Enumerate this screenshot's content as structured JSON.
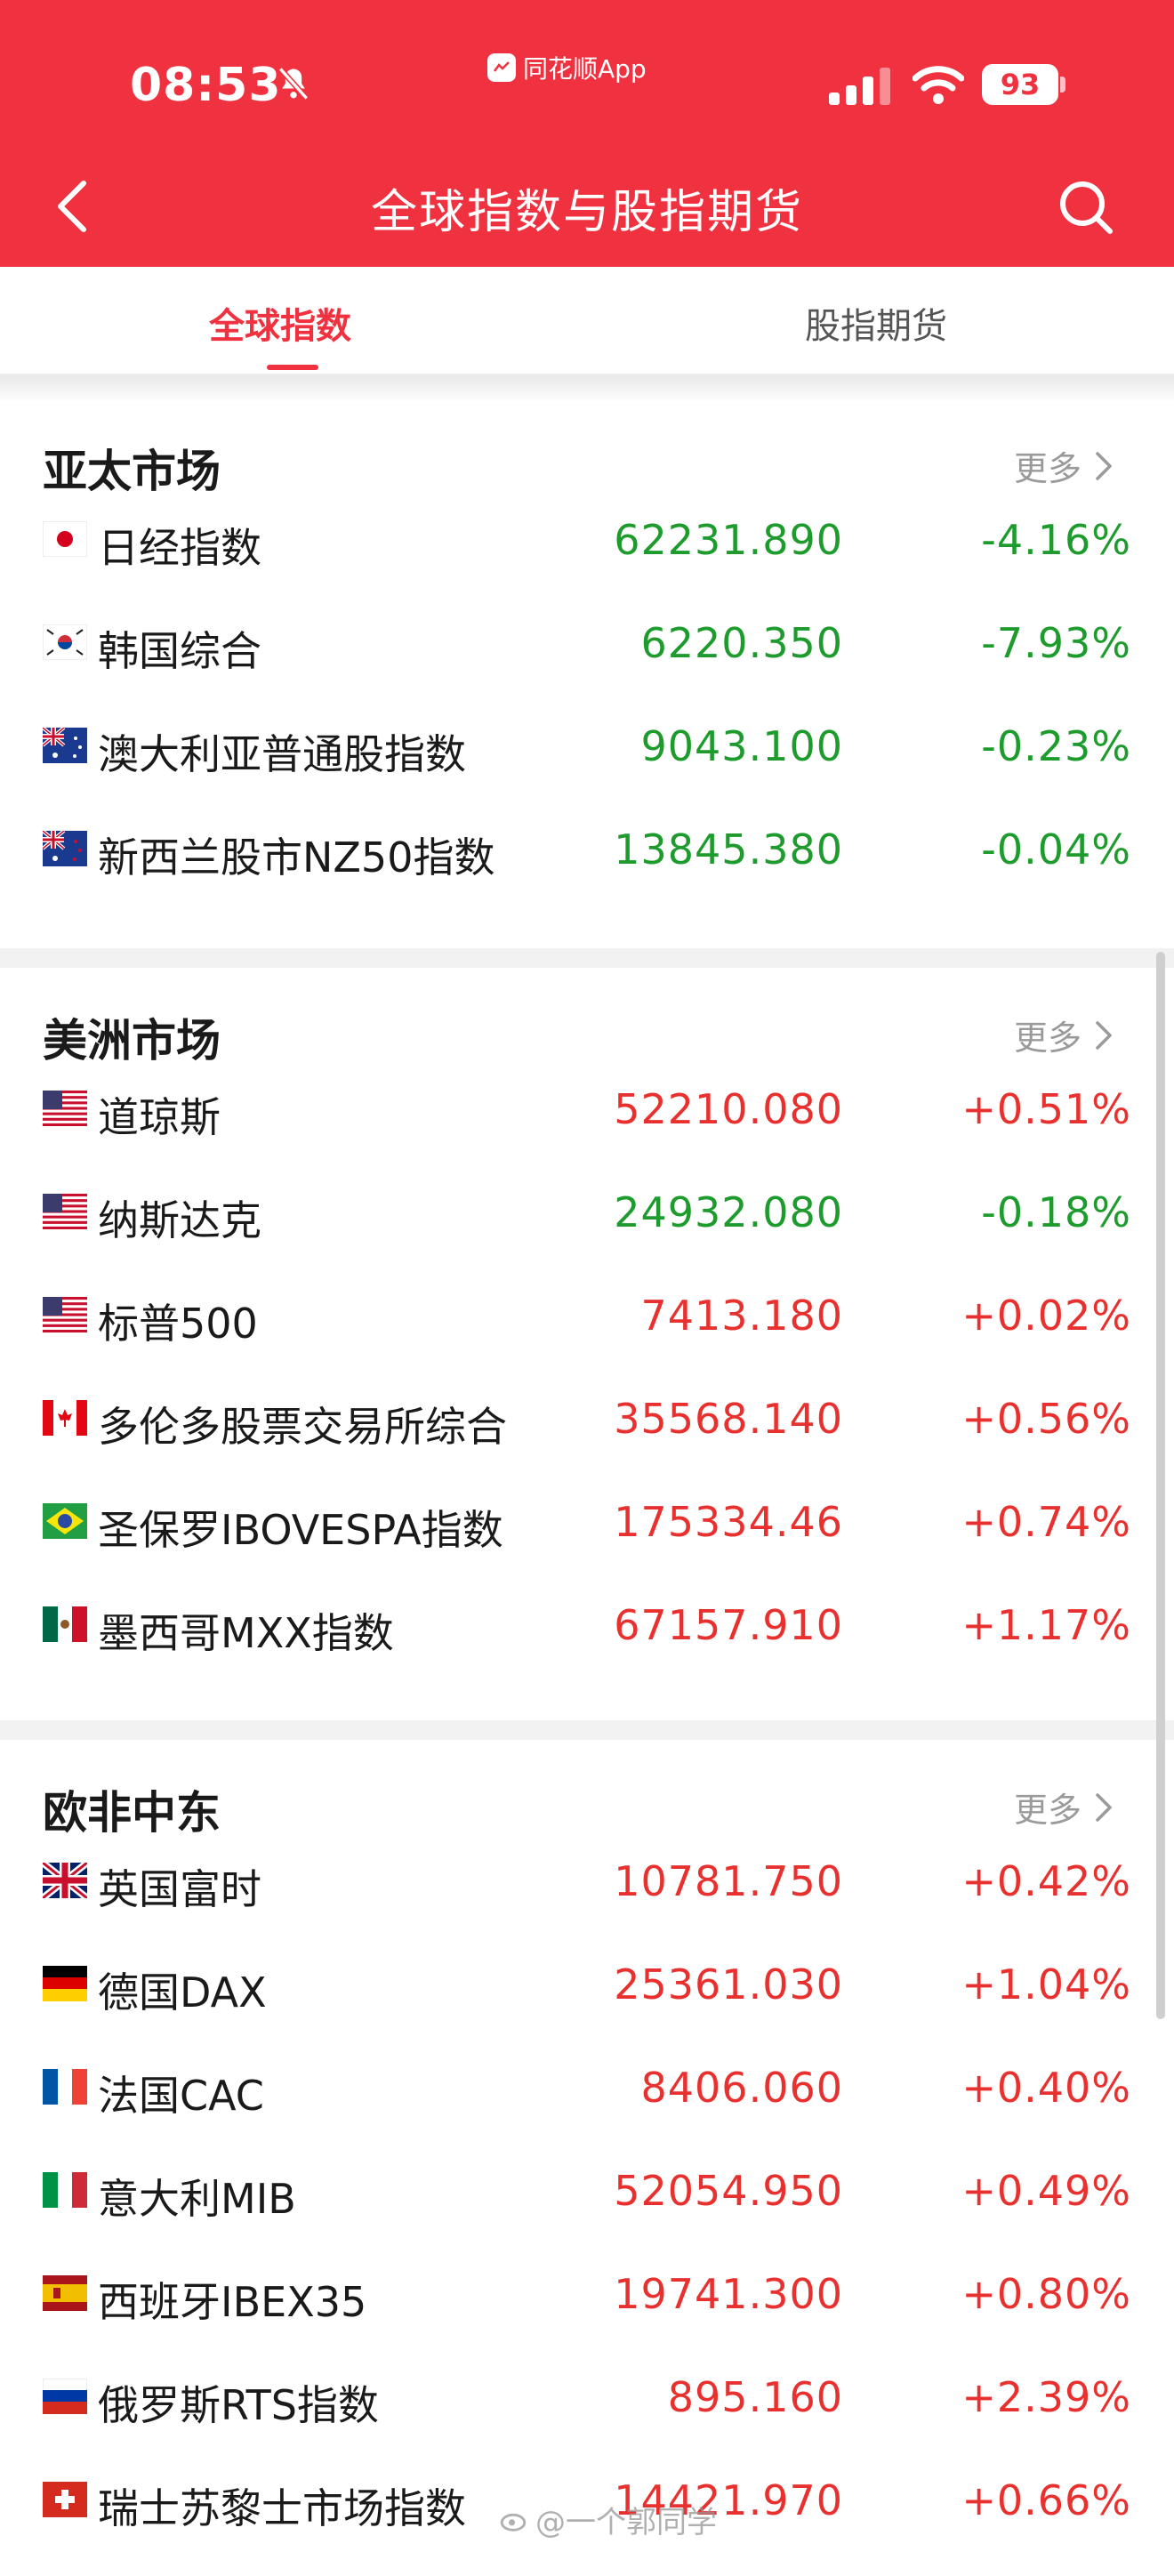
{
  "status_bar": {
    "time": "08:53",
    "app_label": "同花顺App",
    "battery": "93"
  },
  "nav": {
    "title": "全球指数与股指期货"
  },
  "tabs": [
    {
      "label": "全球指数",
      "active": true
    },
    {
      "label": "股指期货",
      "active": false
    }
  ],
  "colors": {
    "brand_red": "#f0313f",
    "up": "#e8312f",
    "down": "#1d9b2c"
  },
  "sections": [
    {
      "title": "亚太市场",
      "more_label": "更多",
      "rows": [
        {
          "flag": "jp",
          "name": "日经指数",
          "value": "62231.890",
          "change": "-4.16%",
          "direction": "down"
        },
        {
          "flag": "kr",
          "name": "韩国综合",
          "value": "6220.350",
          "change": "-7.93%",
          "direction": "down"
        },
        {
          "flag": "au",
          "name": "澳大利亚普通股指数",
          "value": "9043.100",
          "change": "-0.23%",
          "direction": "down"
        },
        {
          "flag": "nz",
          "name": "新西兰股市NZ50指数",
          "value": "13845.380",
          "change": "-0.04%",
          "direction": "down"
        }
      ]
    },
    {
      "title": "美洲市场",
      "more_label": "更多",
      "rows": [
        {
          "flag": "us",
          "name": "道琼斯",
          "value": "52210.080",
          "change": "+0.51%",
          "direction": "up"
        },
        {
          "flag": "us",
          "name": "纳斯达克",
          "value": "24932.080",
          "change": "-0.18%",
          "direction": "down"
        },
        {
          "flag": "us",
          "name": "标普500",
          "value": "7413.180",
          "change": "+0.02%",
          "direction": "up"
        },
        {
          "flag": "ca",
          "name": "多伦多股票交易所综合",
          "value": "35568.140",
          "change": "+0.56%",
          "direction": "up"
        },
        {
          "flag": "br",
          "name": "圣保罗IBOVESPA指数",
          "value": "175334.46",
          "change": "+0.74%",
          "direction": "up"
        },
        {
          "flag": "mx",
          "name": "墨西哥MXX指数",
          "value": "67157.910",
          "change": "+1.17%",
          "direction": "up"
        }
      ]
    },
    {
      "title": "欧非中东",
      "more_label": "更多",
      "rows": [
        {
          "flag": "gb",
          "name": "英国富时",
          "value": "10781.750",
          "change": "+0.42%",
          "direction": "up"
        },
        {
          "flag": "de",
          "name": "德国DAX",
          "value": "25361.030",
          "change": "+1.04%",
          "direction": "up"
        },
        {
          "flag": "fr",
          "name": "法国CAC",
          "value": "8406.060",
          "change": "+0.40%",
          "direction": "up"
        },
        {
          "flag": "it",
          "name": "意大利MIB",
          "value": "52054.950",
          "change": "+0.49%",
          "direction": "up"
        },
        {
          "flag": "es",
          "name": "西班牙IBEX35",
          "value": "19741.300",
          "change": "+0.80%",
          "direction": "up"
        },
        {
          "flag": "ru",
          "name": "俄罗斯RTS指数",
          "value": "895.160",
          "change": "+2.39%",
          "direction": "up"
        },
        {
          "flag": "ch",
          "name": "瑞士苏黎士市场指数",
          "value": "14421.970",
          "change": "+0.66%",
          "direction": "up"
        }
      ]
    }
  ],
  "watermark": "@一个郭同学"
}
